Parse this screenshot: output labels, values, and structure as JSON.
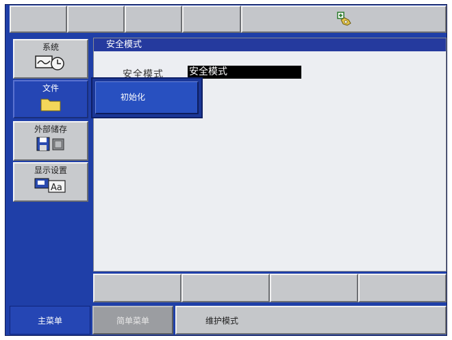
{
  "top_bar": {
    "status_icon": "teach-pendant-icon"
  },
  "sidebar": {
    "items": [
      {
        "label": "系统",
        "icon": "system-monitor-clock-icon"
      },
      {
        "label": "文件",
        "icon": "folder-icon"
      },
      {
        "label": "外部储存",
        "icon": "external-storage-icon"
      },
      {
        "label": "显示设置",
        "icon": "display-settings-icon"
      }
    ]
  },
  "main": {
    "title": "安全模式",
    "field_label": "安全模式",
    "field_value": "安全模式"
  },
  "popup": {
    "items": [
      {
        "label": "初始化"
      }
    ]
  },
  "bottom_bar": {
    "main_menu": "主菜单",
    "simple_menu": "简单菜单",
    "mode_text": "维护模式"
  },
  "colors": {
    "accent_blue": "#2546b4",
    "title_blue": "#253a9e",
    "panel_gray": "#c6c8cb"
  }
}
